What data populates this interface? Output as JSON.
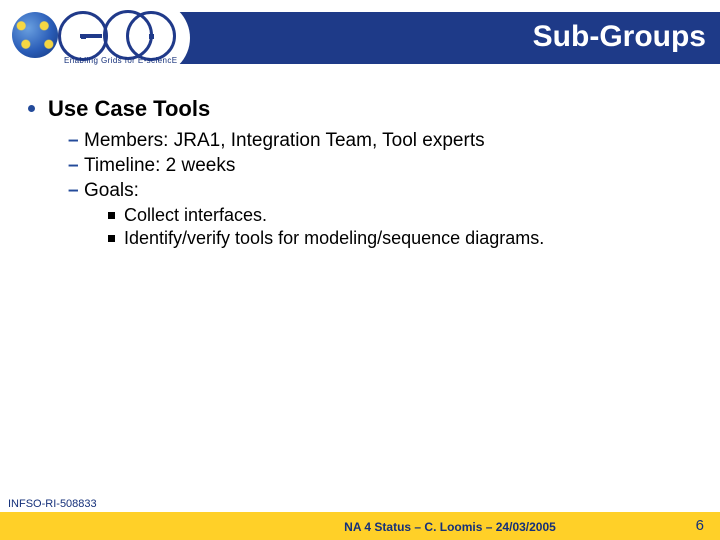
{
  "header": {
    "title": "Sub-Groups"
  },
  "logo": {
    "tagline": "Enabling Grids for E-sciencE"
  },
  "body": {
    "topic": "Use Case Tools",
    "details": {
      "members": "Members: JRA1, Integration Team, Tool experts",
      "timeline": "Timeline: 2 weeks",
      "goals_label": "Goals:",
      "goals": [
        "Collect interfaces.",
        "Identify/verify tools for modeling/sequence diagrams."
      ]
    }
  },
  "footer": {
    "ref": "INFSO-RI-508833",
    "status": "NA 4 Status – C. Loomis – 24/03/2005",
    "page": "6"
  }
}
